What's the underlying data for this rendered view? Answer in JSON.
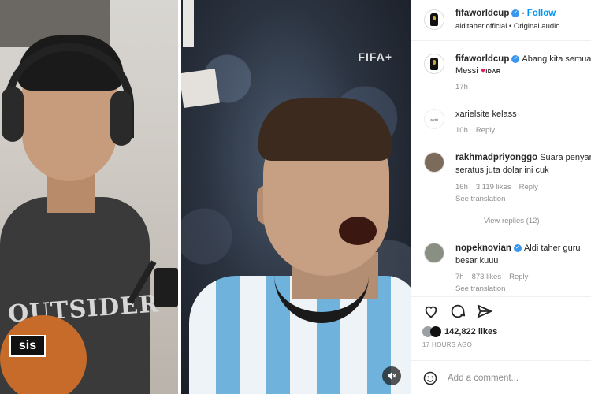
{
  "video": {
    "watermark": "FIFA",
    "shirt_text": "OUTSIDER",
    "sticker_text": "sis"
  },
  "header": {
    "username": "fifaworldcup",
    "follow_label": "Follow",
    "audio_line": "alditaher.official • Original audio"
  },
  "caption": {
    "username": "fifaworldcup",
    "text_line1": "Abang kita semua",
    "text_line2": "Messi",
    "emoji_label": "IDAR",
    "time": "17h"
  },
  "comments": [
    {
      "username": "xarielsite",
      "text_line1": "kelass",
      "text_line2": "",
      "time": "10h",
      "likes": "",
      "reply_label": "Reply",
      "see_translation": ""
    },
    {
      "username": "rakhmadpriyonggo",
      "text_line1": "Suara penyanyi",
      "text_line2": "seratus juta dolar ini cuk",
      "time": "16h",
      "likes": "3,119 likes",
      "reply_label": "Reply",
      "see_translation": "See translation"
    },
    {
      "username": "nopeknovian",
      "text_line1": "Aldi taher guru",
      "text_line2": "besar kuuu",
      "time": "7h",
      "likes": "873 likes",
      "reply_label": "Reply",
      "see_translation": "See translation"
    }
  ],
  "view_replies": "View replies (12)",
  "actions": {
    "like_icon": "heart-icon",
    "comment_icon": "comment-icon",
    "share_icon": "send-icon"
  },
  "likes_count": "142,822 likes",
  "posted_ago": "17 HOURS AGO",
  "add_comment_placeholder": "Add a comment...",
  "colors": {
    "accent": "#0095f6",
    "text": "#262626",
    "muted": "#8e8e8e"
  }
}
